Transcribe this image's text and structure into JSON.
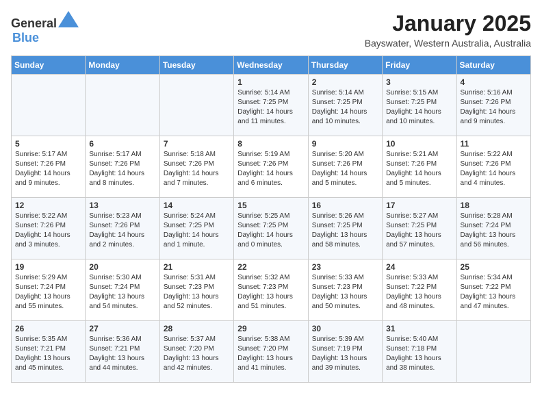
{
  "header": {
    "logo_general": "General",
    "logo_blue": "Blue",
    "month": "January 2025",
    "location": "Bayswater, Western Australia, Australia"
  },
  "weekdays": [
    "Sunday",
    "Monday",
    "Tuesday",
    "Wednesday",
    "Thursday",
    "Friday",
    "Saturday"
  ],
  "weeks": [
    [
      {
        "day": "",
        "info": ""
      },
      {
        "day": "",
        "info": ""
      },
      {
        "day": "",
        "info": ""
      },
      {
        "day": "1",
        "info": "Sunrise: 5:14 AM\nSunset: 7:25 PM\nDaylight: 14 hours\nand 11 minutes."
      },
      {
        "day": "2",
        "info": "Sunrise: 5:14 AM\nSunset: 7:25 PM\nDaylight: 14 hours\nand 10 minutes."
      },
      {
        "day": "3",
        "info": "Sunrise: 5:15 AM\nSunset: 7:25 PM\nDaylight: 14 hours\nand 10 minutes."
      },
      {
        "day": "4",
        "info": "Sunrise: 5:16 AM\nSunset: 7:26 PM\nDaylight: 14 hours\nand 9 minutes."
      }
    ],
    [
      {
        "day": "5",
        "info": "Sunrise: 5:17 AM\nSunset: 7:26 PM\nDaylight: 14 hours\nand 9 minutes."
      },
      {
        "day": "6",
        "info": "Sunrise: 5:17 AM\nSunset: 7:26 PM\nDaylight: 14 hours\nand 8 minutes."
      },
      {
        "day": "7",
        "info": "Sunrise: 5:18 AM\nSunset: 7:26 PM\nDaylight: 14 hours\nand 7 minutes."
      },
      {
        "day": "8",
        "info": "Sunrise: 5:19 AM\nSunset: 7:26 PM\nDaylight: 14 hours\nand 6 minutes."
      },
      {
        "day": "9",
        "info": "Sunrise: 5:20 AM\nSunset: 7:26 PM\nDaylight: 14 hours\nand 5 minutes."
      },
      {
        "day": "10",
        "info": "Sunrise: 5:21 AM\nSunset: 7:26 PM\nDaylight: 14 hours\nand 5 minutes."
      },
      {
        "day": "11",
        "info": "Sunrise: 5:22 AM\nSunset: 7:26 PM\nDaylight: 14 hours\nand 4 minutes."
      }
    ],
    [
      {
        "day": "12",
        "info": "Sunrise: 5:22 AM\nSunset: 7:26 PM\nDaylight: 14 hours\nand 3 minutes."
      },
      {
        "day": "13",
        "info": "Sunrise: 5:23 AM\nSunset: 7:26 PM\nDaylight: 14 hours\nand 2 minutes."
      },
      {
        "day": "14",
        "info": "Sunrise: 5:24 AM\nSunset: 7:25 PM\nDaylight: 14 hours\nand 1 minute."
      },
      {
        "day": "15",
        "info": "Sunrise: 5:25 AM\nSunset: 7:25 PM\nDaylight: 14 hours\nand 0 minutes."
      },
      {
        "day": "16",
        "info": "Sunrise: 5:26 AM\nSunset: 7:25 PM\nDaylight: 13 hours\nand 58 minutes."
      },
      {
        "day": "17",
        "info": "Sunrise: 5:27 AM\nSunset: 7:25 PM\nDaylight: 13 hours\nand 57 minutes."
      },
      {
        "day": "18",
        "info": "Sunrise: 5:28 AM\nSunset: 7:24 PM\nDaylight: 13 hours\nand 56 minutes."
      }
    ],
    [
      {
        "day": "19",
        "info": "Sunrise: 5:29 AM\nSunset: 7:24 PM\nDaylight: 13 hours\nand 55 minutes."
      },
      {
        "day": "20",
        "info": "Sunrise: 5:30 AM\nSunset: 7:24 PM\nDaylight: 13 hours\nand 54 minutes."
      },
      {
        "day": "21",
        "info": "Sunrise: 5:31 AM\nSunset: 7:23 PM\nDaylight: 13 hours\nand 52 minutes."
      },
      {
        "day": "22",
        "info": "Sunrise: 5:32 AM\nSunset: 7:23 PM\nDaylight: 13 hours\nand 51 minutes."
      },
      {
        "day": "23",
        "info": "Sunrise: 5:33 AM\nSunset: 7:23 PM\nDaylight: 13 hours\nand 50 minutes."
      },
      {
        "day": "24",
        "info": "Sunrise: 5:33 AM\nSunset: 7:22 PM\nDaylight: 13 hours\nand 48 minutes."
      },
      {
        "day": "25",
        "info": "Sunrise: 5:34 AM\nSunset: 7:22 PM\nDaylight: 13 hours\nand 47 minutes."
      }
    ],
    [
      {
        "day": "26",
        "info": "Sunrise: 5:35 AM\nSunset: 7:21 PM\nDaylight: 13 hours\nand 45 minutes."
      },
      {
        "day": "27",
        "info": "Sunrise: 5:36 AM\nSunset: 7:21 PM\nDaylight: 13 hours\nand 44 minutes."
      },
      {
        "day": "28",
        "info": "Sunrise: 5:37 AM\nSunset: 7:20 PM\nDaylight: 13 hours\nand 42 minutes."
      },
      {
        "day": "29",
        "info": "Sunrise: 5:38 AM\nSunset: 7:20 PM\nDaylight: 13 hours\nand 41 minutes."
      },
      {
        "day": "30",
        "info": "Sunrise: 5:39 AM\nSunset: 7:19 PM\nDaylight: 13 hours\nand 39 minutes."
      },
      {
        "day": "31",
        "info": "Sunrise: 5:40 AM\nSunset: 7:18 PM\nDaylight: 13 hours\nand 38 minutes."
      },
      {
        "day": "",
        "info": ""
      }
    ]
  ]
}
